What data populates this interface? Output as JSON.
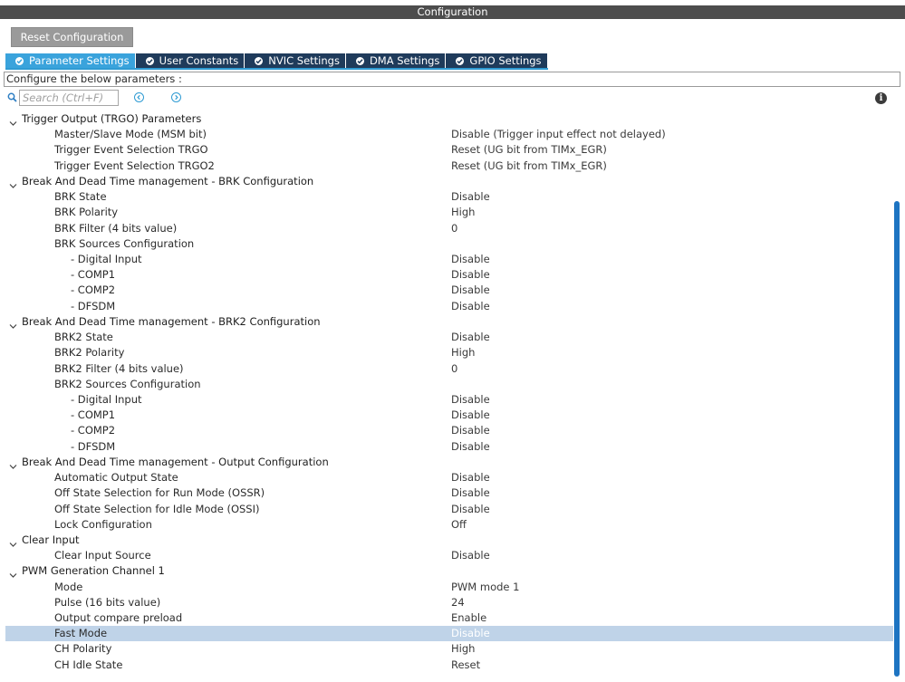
{
  "window": {
    "title": "Configuration"
  },
  "toolbar": {
    "reset_label": "Reset Configuration"
  },
  "tabs": [
    {
      "label": "Parameter Settings",
      "active": true
    },
    {
      "label": "User Constants",
      "active": false
    },
    {
      "label": "NVIC Settings",
      "active": false
    },
    {
      "label": "DMA Settings",
      "active": false
    },
    {
      "label": "GPIO Settings",
      "active": false
    }
  ],
  "instruction": "Configure the below parameters :",
  "search": {
    "placeholder": "Search (Ctrl+F)"
  },
  "colors": {
    "active_tab": "#3aa3dc",
    "tab": "#1f3b5b",
    "selected_row": "#bfd3e8",
    "scrollbar": "#1d74c2"
  },
  "tree": [
    {
      "kind": "group",
      "name": "Trigger Output (TRGO) Parameters"
    },
    {
      "kind": "param",
      "level": 1,
      "name": "Master/Slave Mode (MSM bit)",
      "value": "Disable (Trigger input effect not delayed)"
    },
    {
      "kind": "param",
      "level": 1,
      "name": "Trigger Event Selection TRGO",
      "value": "Reset (UG bit from TIMx_EGR)"
    },
    {
      "kind": "param",
      "level": 1,
      "name": "Trigger Event Selection TRGO2",
      "value": "Reset (UG bit from TIMx_EGR)"
    },
    {
      "kind": "group",
      "name": "Break And Dead Time management - BRK Configuration"
    },
    {
      "kind": "param",
      "level": 1,
      "name": "BRK State",
      "value": "Disable"
    },
    {
      "kind": "param",
      "level": 1,
      "name": "BRK Polarity",
      "value": "High"
    },
    {
      "kind": "param",
      "level": 1,
      "name": "BRK Filter (4 bits value)",
      "value": "0"
    },
    {
      "kind": "param",
      "level": 1,
      "name": "BRK Sources Configuration",
      "value": ""
    },
    {
      "kind": "param",
      "level": 2,
      "name": "- Digital Input",
      "value": "Disable"
    },
    {
      "kind": "param",
      "level": 2,
      "name": "- COMP1",
      "value": "Disable"
    },
    {
      "kind": "param",
      "level": 2,
      "name": "- COMP2",
      "value": "Disable"
    },
    {
      "kind": "param",
      "level": 2,
      "name": "- DFSDM",
      "value": "Disable"
    },
    {
      "kind": "group",
      "name": "Break And Dead Time management - BRK2 Configuration"
    },
    {
      "kind": "param",
      "level": 1,
      "name": "BRK2 State",
      "value": "Disable"
    },
    {
      "kind": "param",
      "level": 1,
      "name": "BRK2 Polarity",
      "value": "High"
    },
    {
      "kind": "param",
      "level": 1,
      "name": "BRK2 Filter (4 bits value)",
      "value": "0"
    },
    {
      "kind": "param",
      "level": 1,
      "name": "BRK2 Sources Configuration",
      "value": ""
    },
    {
      "kind": "param",
      "level": 2,
      "name": "- Digital Input",
      "value": "Disable"
    },
    {
      "kind": "param",
      "level": 2,
      "name": "- COMP1",
      "value": "Disable"
    },
    {
      "kind": "param",
      "level": 2,
      "name": "- COMP2",
      "value": "Disable"
    },
    {
      "kind": "param",
      "level": 2,
      "name": "- DFSDM",
      "value": "Disable"
    },
    {
      "kind": "group",
      "name": "Break And Dead Time management - Output Configuration"
    },
    {
      "kind": "param",
      "level": 1,
      "name": "Automatic Output State",
      "value": "Disable"
    },
    {
      "kind": "param",
      "level": 1,
      "name": "Off State Selection for Run Mode (OSSR)",
      "value": "Disable"
    },
    {
      "kind": "param",
      "level": 1,
      "name": "Off State Selection for Idle Mode (OSSI)",
      "value": "Disable"
    },
    {
      "kind": "param",
      "level": 1,
      "name": "Lock Configuration",
      "value": "Off"
    },
    {
      "kind": "group",
      "name": "Clear Input"
    },
    {
      "kind": "param",
      "level": 1,
      "name": "Clear Input Source",
      "value": "Disable"
    },
    {
      "kind": "group",
      "name": "PWM Generation Channel 1"
    },
    {
      "kind": "param",
      "level": 1,
      "name": "Mode",
      "value": "PWM mode 1"
    },
    {
      "kind": "param",
      "level": 1,
      "name": "Pulse (16 bits value)",
      "value": "24"
    },
    {
      "kind": "param",
      "level": 1,
      "name": "Output compare preload",
      "value": "Enable"
    },
    {
      "kind": "param",
      "level": 1,
      "name": "Fast Mode",
      "value": "Disable",
      "selected": true
    },
    {
      "kind": "param",
      "level": 1,
      "name": "CH Polarity",
      "value": "High"
    },
    {
      "kind": "param",
      "level": 1,
      "name": "CH Idle State",
      "value": "Reset"
    }
  ]
}
